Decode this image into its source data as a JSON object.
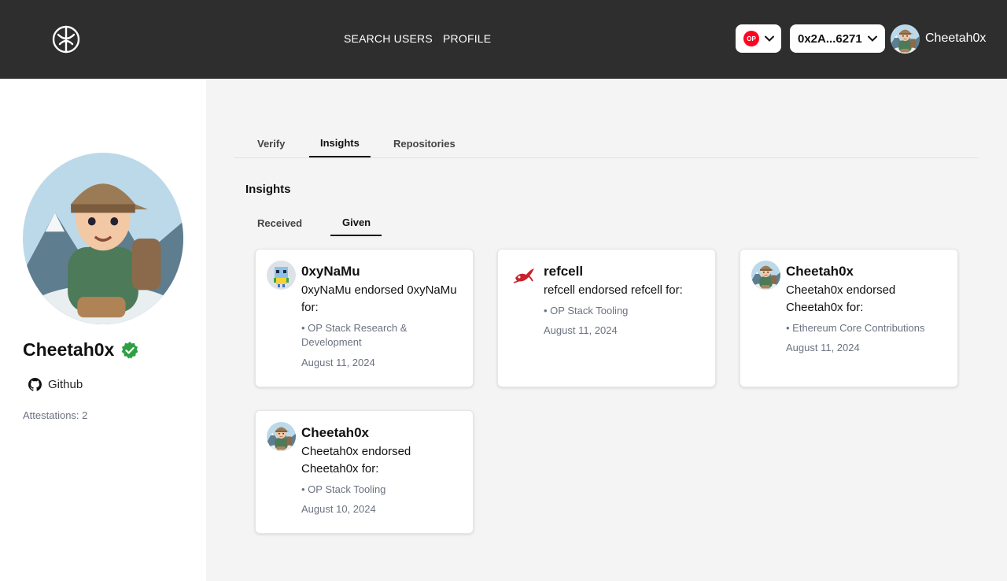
{
  "header": {
    "nav": {
      "search_users": "SEARCH USERS",
      "profile": "PROFILE"
    },
    "network": {
      "badge": "OP",
      "color": "#ff0420"
    },
    "wallet": {
      "address": "0x2A...6271"
    },
    "user": {
      "name": "Cheetah0x"
    }
  },
  "sidebar": {
    "name": "Cheetah0x",
    "github_label": "Github",
    "attestations": "Attestations: 2",
    "verified_color": "#2ea043"
  },
  "main": {
    "tabs": [
      {
        "label": "Verify"
      },
      {
        "label": "Insights",
        "active": true
      },
      {
        "label": "Repositories"
      }
    ],
    "section_title": "Insights",
    "subtabs": [
      {
        "label": "Received"
      },
      {
        "label": "Given",
        "active": true
      }
    ],
    "cards": [
      {
        "name": "0xyNaMu",
        "description": "0xyNaMu endorsed 0xyNaMu for:",
        "skill": "• OP Stack Research & Development",
        "date": "August 11, 2024",
        "avatar": "pixel-robot-avatar"
      },
      {
        "name": "refcell",
        "description": "refcell endorsed refcell for:",
        "skill": "• OP Stack Tooling",
        "date": "August 11, 2024",
        "avatar": "red-bird-avatar"
      },
      {
        "name": "Cheetah0x",
        "description": "Cheetah0x endorsed Cheetah0x for:",
        "skill": "• Ethereum Core Contributions",
        "date": "August 11, 2024",
        "avatar": "hiker-avatar"
      },
      {
        "name": "Cheetah0x",
        "description": "Cheetah0x endorsed Cheetah0x for:",
        "skill": "• OP Stack Tooling",
        "date": "August 10, 2024",
        "avatar": "hiker-avatar"
      }
    ]
  }
}
